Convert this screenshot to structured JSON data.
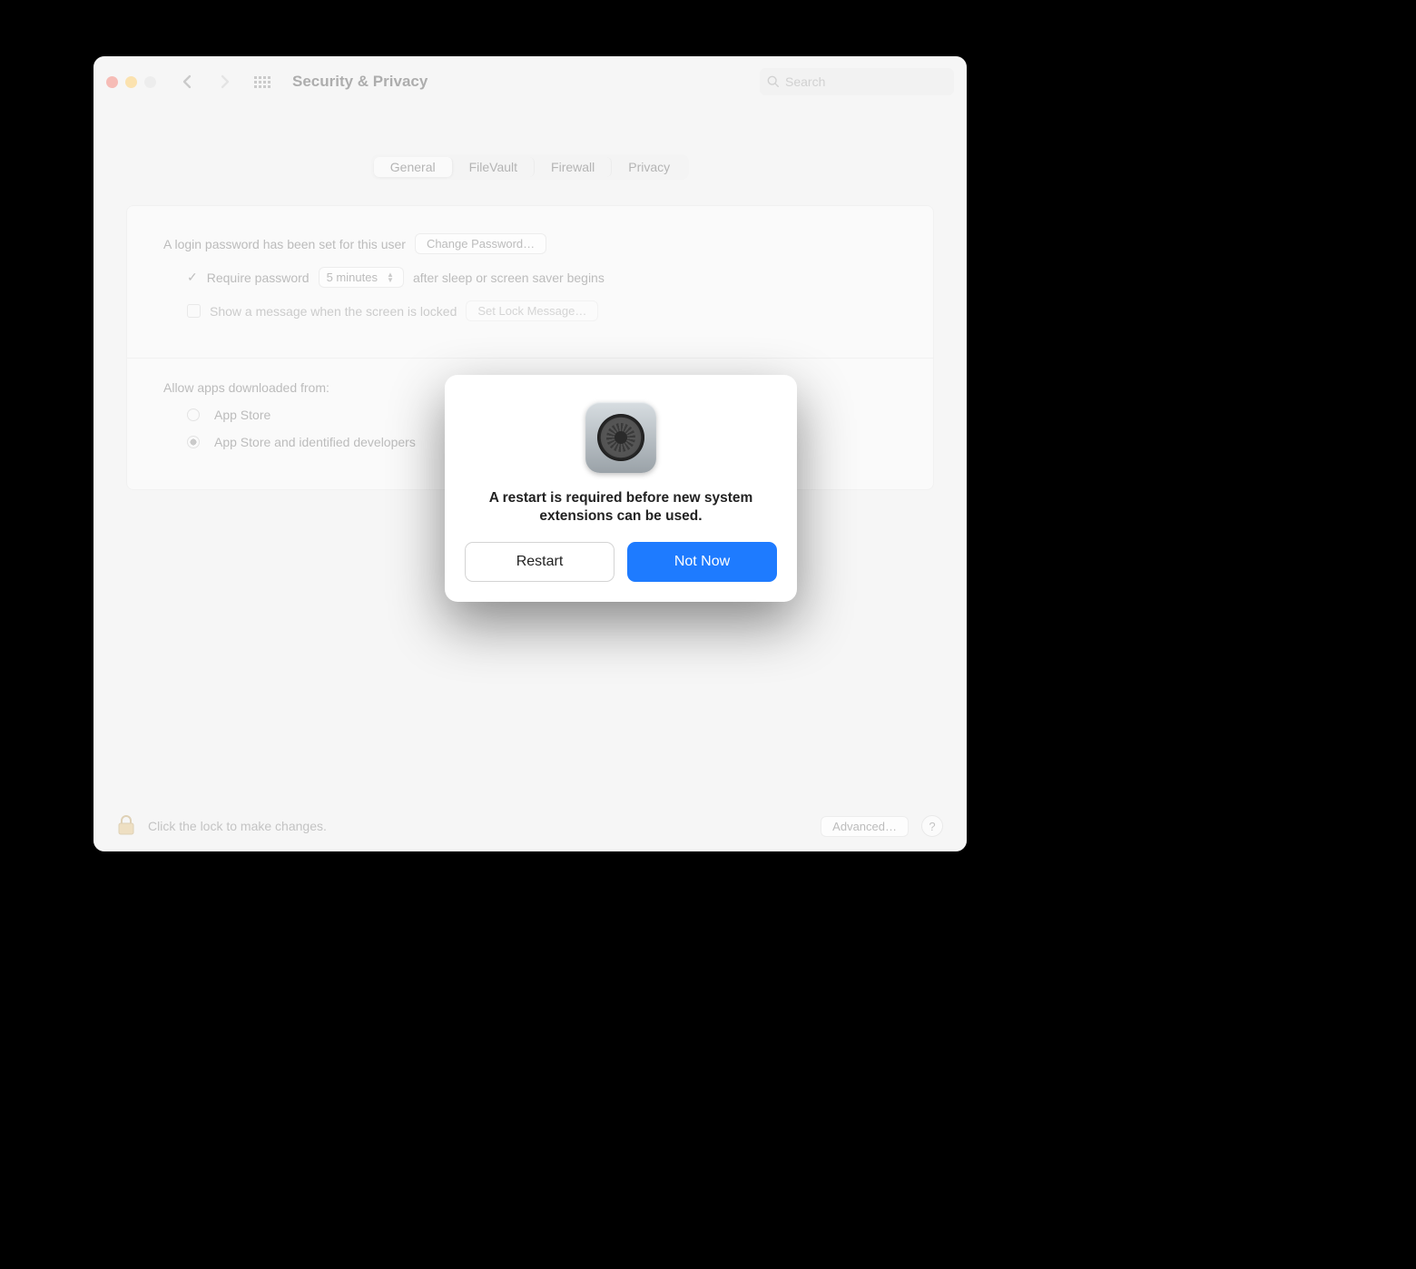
{
  "window": {
    "title": "Security & Privacy"
  },
  "search": {
    "placeholder": "Search"
  },
  "tabs": [
    "General",
    "FileVault",
    "Firewall",
    "Privacy"
  ],
  "loginRow": {
    "text": "A login password has been set for this user",
    "changeBtn": "Change Password…"
  },
  "requireRow": {
    "label": "Require password",
    "select": "5 minutes",
    "after": "after sleep or screen saver begins"
  },
  "lockMsgRow": {
    "label": "Show a message when the screen is locked",
    "setBtn": "Set Lock Message…"
  },
  "downloadSection": {
    "heading": "Allow apps downloaded from:",
    "opt1": "App Store",
    "opt2": "App Store and identified developers"
  },
  "footer": {
    "lockText": "Click the lock to make changes.",
    "advanced": "Advanced…",
    "help": "?"
  },
  "alert": {
    "message": "A restart is required before new system extensions can be used.",
    "restart": "Restart",
    "notnow": "Not Now"
  }
}
